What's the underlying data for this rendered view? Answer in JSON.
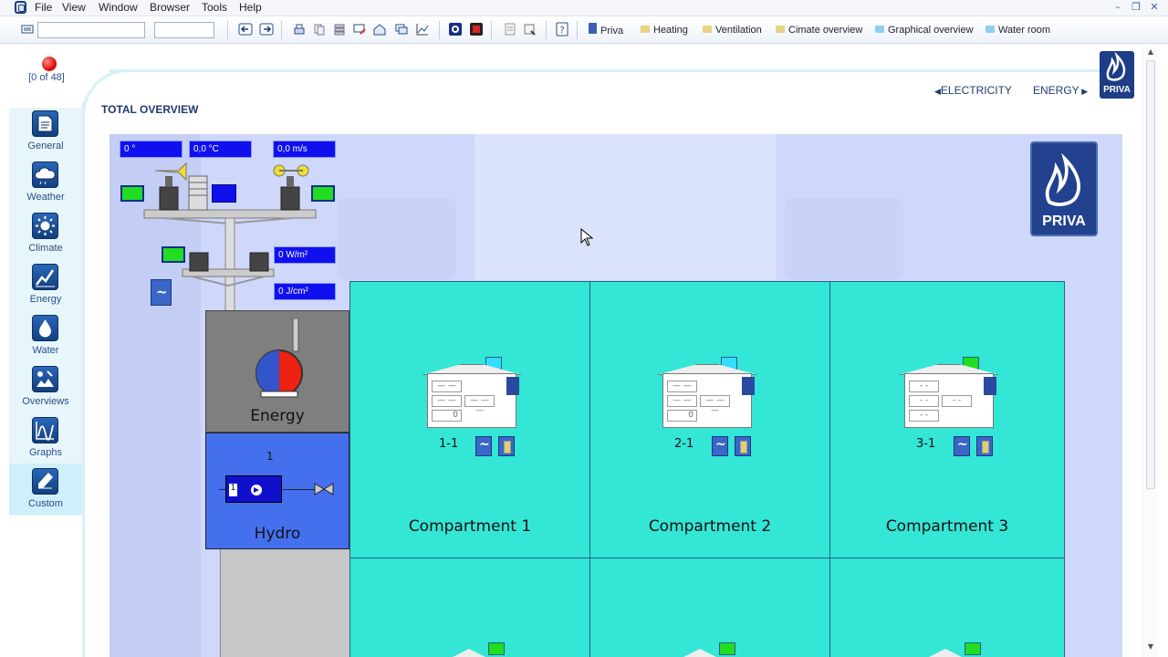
{
  "menubar": {
    "items": [
      "File",
      "View",
      "Window",
      "Browser",
      "Tools",
      "Help"
    ]
  },
  "toolbar": {
    "links": [
      {
        "label": "Priva",
        "color": "#3a5fb0"
      },
      {
        "label": "Heating",
        "color": "#e8d480"
      },
      {
        "label": "Ventilation",
        "color": "#e8d480"
      },
      {
        "label": "Cimate overview",
        "color": "#e8d480"
      },
      {
        "label": "Graphical overview",
        "color": "#8fd0f0"
      },
      {
        "label": "Water room",
        "color": "#8fd0f0"
      }
    ]
  },
  "alarm": {
    "count_text": "[0 of 48]",
    "color": "#e01010"
  },
  "nav": {
    "items": [
      {
        "label": "General",
        "icon": "document-icon"
      },
      {
        "label": "Weather",
        "icon": "cloud-icon"
      },
      {
        "label": "Climate",
        "icon": "sun-icon"
      },
      {
        "label": "Energy",
        "icon": "energy-graph-icon"
      },
      {
        "label": "Water",
        "icon": "drop-icon"
      },
      {
        "label": "Overviews",
        "icon": "overview-icon"
      },
      {
        "label": "Graphs",
        "icon": "graph-icon"
      },
      {
        "label": "Custom",
        "icon": "pencil-icon"
      }
    ],
    "active": "Custom"
  },
  "page": {
    "title": "TOTAL OVERVIEW",
    "prev_link": "ELECTRICITY",
    "next_link": "ENERGY",
    "brand": "PRIVA"
  },
  "weather": {
    "wind_direction": "0 °",
    "temperature": "0,0 °C",
    "wind_speed": "0,0 m/s",
    "radiation": "0 W/m²",
    "radiation_sum": "0 J/cm²"
  },
  "energy": {
    "label": "Energy"
  },
  "hydro": {
    "label": "Hydro",
    "number": "1",
    "pump_number": "1"
  },
  "compartments": [
    {
      "name": "Compartment 1",
      "code": "1-1",
      "indicator": "#33ddff",
      "cell_value": "0"
    },
    {
      "name": "Compartment 2",
      "code": "2-1",
      "indicator": "#33ddff",
      "cell_value": "0"
    },
    {
      "name": "Compartment 3",
      "code": "3-1",
      "indicator": "#22dd22",
      "cell_value": ""
    }
  ]
}
